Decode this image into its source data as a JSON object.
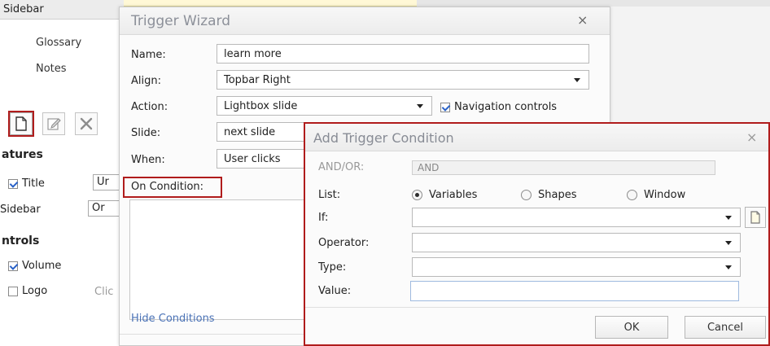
{
  "sidebar_panel": {
    "header": "Sidebar",
    "links": [
      "Glossary",
      "Notes"
    ],
    "features_title": "atures",
    "features": [
      {
        "label": "Title",
        "checked": true,
        "field_value": "Ur"
      },
      {
        "label": "Sidebar",
        "checked": false,
        "field_value": "Or"
      }
    ],
    "controls_title": "ntrols",
    "controls": [
      {
        "label": "Volume",
        "checked": true
      },
      {
        "label": "Logo",
        "checked": false,
        "aside": "Clic"
      }
    ]
  },
  "wizard": {
    "title": "Trigger Wizard",
    "close_glyph": "×",
    "name_label": "Name:",
    "name_value": "learn more",
    "align_label": "Align:",
    "align_value": "Topbar Right",
    "action_label": "Action:",
    "action_value": "Lightbox slide",
    "nav_controls_label": "Navigation controls",
    "nav_controls_checked": true,
    "slide_label": "Slide:",
    "slide_value": "next slide",
    "when_label": "When:",
    "when_value": "User clicks",
    "on_condition_label": "On Condition:",
    "hide_conditions_link": "Hide Conditions"
  },
  "condition_dialog": {
    "title": "Add Trigger Condition",
    "close_glyph": "×",
    "andor_label": "AND/OR:",
    "andor_value": "AND",
    "list_label": "List:",
    "list_options": [
      {
        "label": "Variables",
        "selected": true
      },
      {
        "label": "Shapes",
        "selected": false
      },
      {
        "label": "Window",
        "selected": false
      }
    ],
    "if_label": "If:",
    "if_value": "",
    "operator_label": "Operator:",
    "operator_value": "",
    "type_label": "Type:",
    "type_value": "",
    "value_label": "Value:",
    "value_value": "",
    "ok_label": "OK",
    "cancel_label": "Cancel"
  },
  "colors": {
    "highlight_red": "#b01c1c",
    "link_blue": "#4a72b6",
    "title_grey": "#8c9099"
  }
}
